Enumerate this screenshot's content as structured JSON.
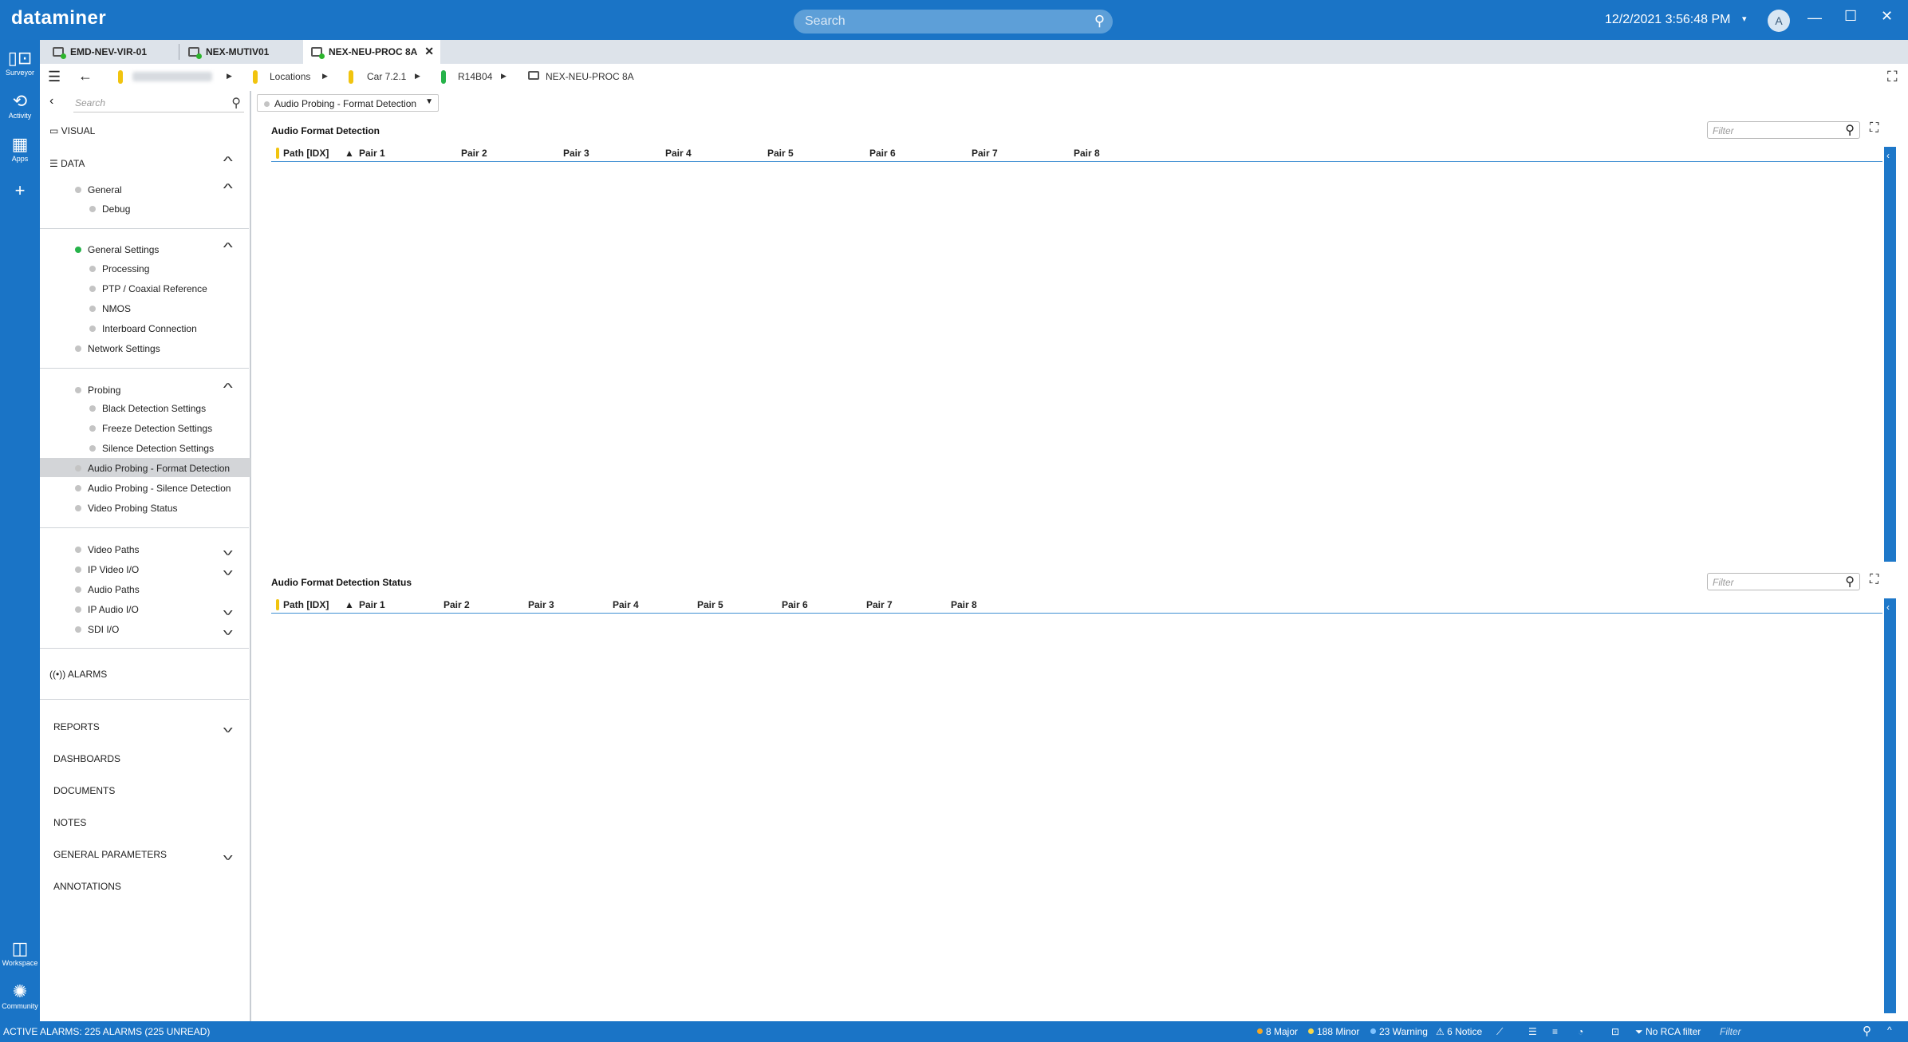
{
  "app": {
    "logo": "dataminer",
    "search_placeholder": "Search",
    "datetime": "12/2/2021 3:56:48 PM",
    "user_initial": "A"
  },
  "rail": {
    "surveyor": "Surveyor",
    "activity": "Activity",
    "apps": "Apps",
    "workspace": "Workspace",
    "community": "Community"
  },
  "tabs": [
    {
      "label": "EMD-NEV-VIR-01"
    },
    {
      "label": "NEX-MUTIV01"
    },
    {
      "label": "NEX-NEU-PROC 8A"
    }
  ],
  "breadcrumb": {
    "locations": "Locations",
    "car": "Car 7.2.1",
    "rack": "R14B04",
    "element": "NEX-NEU-PROC 8A"
  },
  "side": {
    "search_placeholder": "Search",
    "visual": "VISUAL",
    "data": "DATA",
    "general": "General",
    "debug": "Debug",
    "general_settings": "General Settings",
    "processing": "Processing",
    "ptp": "PTP / Coaxial Reference",
    "nmos": "NMOS",
    "interboard": "Interboard Connection",
    "network_settings": "Network Settings",
    "probing": "Probing",
    "black": "Black Detection Settings",
    "freeze": "Freeze Detection Settings",
    "silence": "Silence Detection Settings",
    "audio_format": "Audio Probing - Format Detection",
    "audio_silence": "Audio Probing - Silence Detection",
    "video_status": "Video Probing Status",
    "video_paths": "Video Paths",
    "ip_video": "IP Video I/O",
    "audio_paths": "Audio Paths",
    "ip_audio": "IP Audio I/O",
    "sdi": "SDI I/O",
    "alarms": "ALARMS",
    "reports": "REPORTS",
    "dashboards": "DASHBOARDS",
    "documents": "DOCUMENTS",
    "notes": "NOTES",
    "general_parameters": "GENERAL PARAMETERS",
    "annotations": "ANNOTATIONS"
  },
  "main": {
    "page_selector": "Audio Probing - Format Detection",
    "table1": {
      "title": "Audio Format Detection",
      "filter_placeholder": "Filter",
      "columns": [
        "Path [IDX]",
        "Pair 1",
        "Pair 2",
        "Pair 3",
        "Pair 4",
        "Pair 5",
        "Pair 6",
        "Pair 7",
        "Pair 8"
      ]
    },
    "table2": {
      "title": "Audio Format Detection Status",
      "filter_placeholder": "Filter",
      "columns": [
        "Path [IDX]",
        "Pair 1",
        "Pair 2",
        "Pair 3",
        "Pair 4",
        "Pair 5",
        "Pair 6",
        "Pair 7",
        "Pair 8"
      ]
    }
  },
  "statusbar": {
    "active_alarms": "ACTIVE ALARMS: 225 ALARMS (225 UNREAD)",
    "major": "8 Major",
    "minor": "188 Minor",
    "warning": "23 Warning",
    "notice": "6 Notice",
    "rca": "No RCA filter",
    "filter_placeholder": "Filter"
  },
  "colors": {
    "brand": "#1a74c6",
    "green": "#26b34a",
    "yellow": "#f1c40f",
    "major": "#f5a623",
    "minor": "#f7d84a",
    "warning": "#7fc3ff"
  }
}
